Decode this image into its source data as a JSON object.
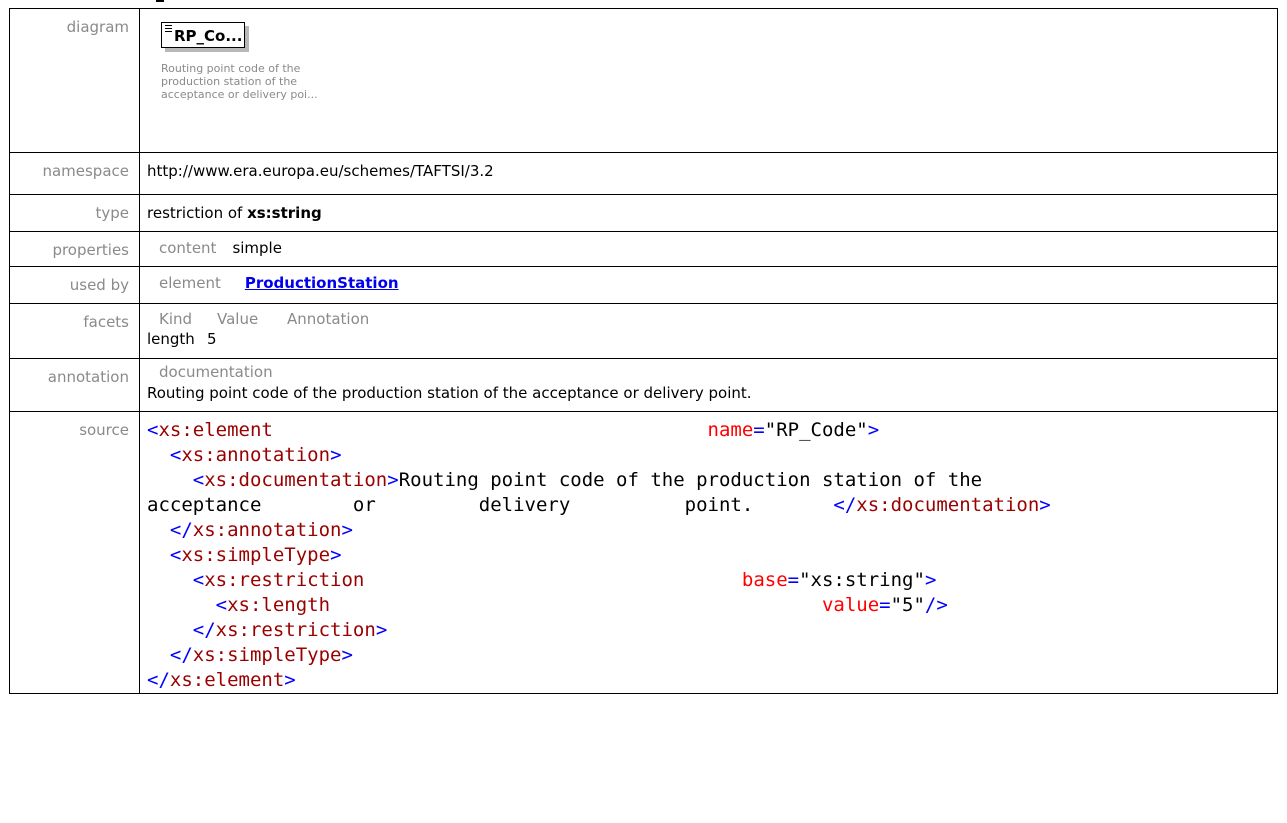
{
  "labels": {
    "diagram": "diagram",
    "namespace": "namespace",
    "type": "type",
    "properties": "properties",
    "used_by": "used by",
    "facets": "facets",
    "annotation": "annotation",
    "source": "source"
  },
  "diagram": {
    "element_name": "RP_Co...",
    "documentation": "Routing point code of the production station of the acceptance or delivery poi..."
  },
  "namespace": "http://www.era.europa.eu/schemes/TAFTSI/3.2",
  "type": {
    "prefix": "restriction of ",
    "base": "xs:string"
  },
  "properties": {
    "label": "content",
    "value": "simple"
  },
  "used_by": {
    "label": "element",
    "link": "ProductionStation"
  },
  "facets": {
    "headers": [
      "Kind",
      "Value",
      "Annotation"
    ],
    "rows": [
      {
        "kind": "length",
        "value": "5",
        "annotation": ""
      }
    ]
  },
  "annotation": {
    "label": "documentation",
    "text": "Routing point code of the production station of the acceptance or delivery point."
  },
  "source": {
    "el_open": "xs:element",
    "name_attr": "name",
    "name_val": "\"RP_Code\"",
    "annotation": "xs:annotation",
    "documentation": "xs:documentation",
    "doc_line1": "Routing point code of the production station of the",
    "doc_w1": "acceptance",
    "doc_w2": "or",
    "doc_w3": "delivery",
    "doc_w4": "point.",
    "simple_type": "xs:simpleType",
    "restriction": "xs:restriction",
    "base_attr": "base",
    "base_val": "\"xs:string\"",
    "length": "xs:length",
    "value_attr": "value",
    "value_val": "\"5\""
  },
  "colors": {
    "label_gray": "#8a8a8a",
    "xml_bracket": "#0000ff",
    "xml_tag": "#990000",
    "xml_attr": "#ff0000",
    "link": "#0000ee"
  }
}
